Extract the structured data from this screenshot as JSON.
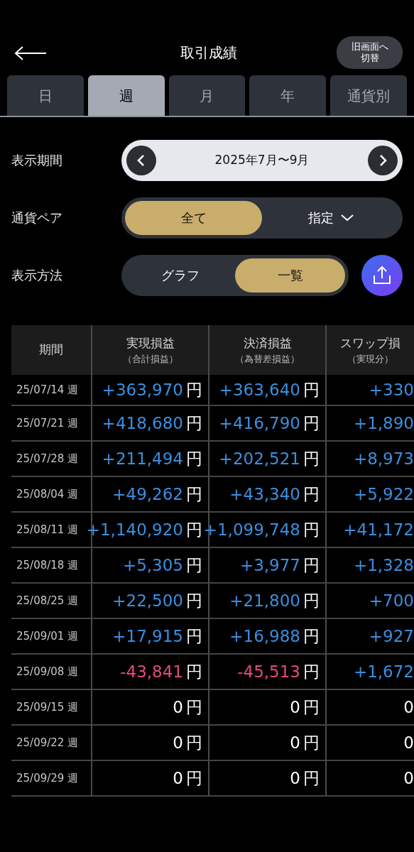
{
  "header": {
    "title": "取引成績",
    "switch_button": "旧画面へ切替"
  },
  "tabs": [
    {
      "label": "日",
      "selected": false
    },
    {
      "label": "週",
      "selected": true
    },
    {
      "label": "月",
      "selected": false
    },
    {
      "label": "年",
      "selected": false
    },
    {
      "label": "通貨別",
      "selected": false
    }
  ],
  "filters": [
    {
      "kind": "period",
      "label": "表示期間",
      "value": "2025年7月〜9月"
    },
    {
      "kind": "segment",
      "label": "通貨ペア",
      "options": [
        {
          "label": "全て",
          "selected": true,
          "dropdown": false
        },
        {
          "label": "指定",
          "selected": false,
          "dropdown": true
        }
      ]
    },
    {
      "kind": "segment",
      "label": "表示方法",
      "share": true,
      "options": [
        {
          "label": "グラフ",
          "selected": false,
          "dropdown": false
        },
        {
          "label": "一覧",
          "selected": true,
          "dropdown": false
        }
      ]
    }
  ],
  "table": {
    "columns": [
      {
        "title": "期間"
      },
      {
        "title": "実現損益",
        "sub": "（合計損益）"
      },
      {
        "title": "決済損益",
        "sub": "（為替差損益）"
      },
      {
        "title": "スワップ損",
        "sub": "（実現分）"
      }
    ],
    "rows": [
      {
        "cells": [
          {
            "kind": "period",
            "value": "25/07/14 週"
          },
          {
            "value": "+363,970",
            "kind": "gain",
            "unit": "円"
          },
          {
            "value": "+363,640",
            "kind": "gain",
            "unit": "円"
          },
          {
            "value": "+330",
            "kind": "gain"
          }
        ]
      },
      {
        "cells": [
          {
            "kind": "period",
            "value": "25/07/21 週"
          },
          {
            "value": "+418,680",
            "kind": "gain",
            "unit": "円"
          },
          {
            "value": "+416,790",
            "kind": "gain",
            "unit": "円"
          },
          {
            "value": "+1,890",
            "kind": "gain"
          }
        ]
      },
      {
        "cells": [
          {
            "kind": "period",
            "value": "25/07/28 週"
          },
          {
            "value": "+211,494",
            "kind": "gain",
            "unit": "円"
          },
          {
            "value": "+202,521",
            "kind": "gain",
            "unit": "円"
          },
          {
            "value": "+8,973",
            "kind": "gain"
          }
        ]
      },
      {
        "cells": [
          {
            "kind": "period",
            "value": "25/08/04 週"
          },
          {
            "value": "+49,262",
            "kind": "gain",
            "unit": "円"
          },
          {
            "value": "+43,340",
            "kind": "gain",
            "unit": "円"
          },
          {
            "value": "+5,922",
            "kind": "gain"
          }
        ]
      },
      {
        "cells": [
          {
            "kind": "period",
            "value": "25/08/11 週"
          },
          {
            "value": "+1,140,920",
            "kind": "gain",
            "unit": "円"
          },
          {
            "value": "+1,099,748",
            "kind": "gain",
            "unit": "円"
          },
          {
            "value": "+41,172",
            "kind": "gain"
          }
        ]
      },
      {
        "cells": [
          {
            "kind": "period",
            "value": "25/08/18 週"
          },
          {
            "value": "+5,305",
            "kind": "gain",
            "unit": "円"
          },
          {
            "value": "+3,977",
            "kind": "gain",
            "unit": "円"
          },
          {
            "value": "+1,328",
            "kind": "gain"
          }
        ]
      },
      {
        "cells": [
          {
            "kind": "period",
            "value": "25/08/25 週"
          },
          {
            "value": "+22,500",
            "kind": "gain",
            "unit": "円"
          },
          {
            "value": "+21,800",
            "kind": "gain",
            "unit": "円"
          },
          {
            "value": "+700",
            "kind": "gain"
          }
        ]
      },
      {
        "cells": [
          {
            "kind": "period",
            "value": "25/09/01 週"
          },
          {
            "value": "+17,915",
            "kind": "gain",
            "unit": "円"
          },
          {
            "value": "+16,988",
            "kind": "gain",
            "unit": "円"
          },
          {
            "value": "+927",
            "kind": "gain"
          }
        ]
      },
      {
        "cells": [
          {
            "kind": "period",
            "value": "25/09/08 週"
          },
          {
            "value": "-43,841",
            "kind": "loss",
            "unit": "円"
          },
          {
            "value": "-45,513",
            "kind": "loss",
            "unit": "円"
          },
          {
            "value": "+1,672",
            "kind": "gain"
          }
        ]
      },
      {
        "cells": [
          {
            "kind": "period",
            "value": "25/09/15 週"
          },
          {
            "value": "0",
            "kind": "zero",
            "unit": "円"
          },
          {
            "value": "0",
            "kind": "zero",
            "unit": "円"
          },
          {
            "value": "0",
            "kind": "zero"
          }
        ]
      },
      {
        "cells": [
          {
            "kind": "period",
            "value": "25/09/22 週"
          },
          {
            "value": "0",
            "kind": "zero",
            "unit": "円"
          },
          {
            "value": "0",
            "kind": "zero",
            "unit": "円"
          },
          {
            "value": "0",
            "kind": "zero"
          }
        ]
      },
      {
        "cells": [
          {
            "kind": "period",
            "value": "25/09/29 週"
          },
          {
            "value": "0",
            "kind": "zero",
            "unit": "円"
          },
          {
            "value": "0",
            "kind": "zero",
            "unit": "円"
          },
          {
            "value": "0",
            "kind": "zero"
          }
        ]
      }
    ]
  }
}
